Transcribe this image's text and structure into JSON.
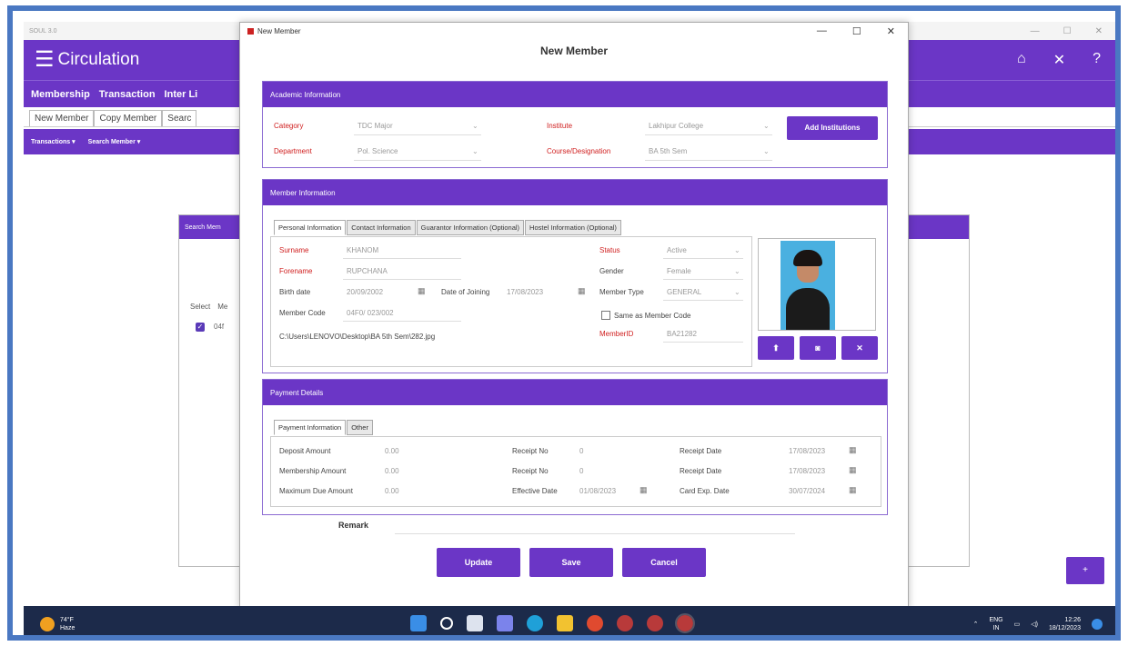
{
  "background_app": {
    "title": "SOUL 3.0",
    "header_title": "Circulation",
    "nav_items": [
      "Membership",
      "Transaction",
      "Inter Li"
    ],
    "tabs": [
      "New Member",
      "Copy Member",
      "Searc"
    ],
    "sub_nav": [
      "Transactions ▾",
      "Search Member ▾"
    ],
    "panel_title": "Search Mem",
    "select_col": "Select",
    "col2": "Me",
    "row_value": "04f",
    "right_button": "+"
  },
  "dialog": {
    "window_title": "New Member",
    "heading": "New Member",
    "academic": {
      "header": "Academic Information",
      "category_label": "Category",
      "category_value": "TDC Major",
      "institute_label": "Institute",
      "institute_value": "Lakhipur College",
      "department_label": "Department",
      "department_value": "Pol. Science",
      "course_label": "Course/Designation",
      "course_value": "BA 5th Sem",
      "add_button": "Add Institutions"
    },
    "member": {
      "header": "Member Information",
      "tabs": [
        "Personal Information",
        "Contact Information",
        "Guarantor Information (Optional)",
        "Hostel Information (Optional)"
      ],
      "surname_label": "Surname",
      "surname_value": "KHANOM",
      "forename_label": "Forename",
      "forename_value": "RUPCHANA",
      "birth_label": "Birth date",
      "birth_value": "20/09/2002",
      "joining_label": "Date of Joining",
      "joining_value": "17/08/2023",
      "member_code_label": "Member Code",
      "member_code_value": "04F0/ 023/002",
      "path": "C:\\Users\\LENOVO\\Desktop\\BA 5th Sem\\282.jpg",
      "status_label": "Status",
      "status_value": "Active",
      "gender_label": "Gender",
      "gender_value": "Female",
      "member_type_label": "Member Type",
      "member_type_value": "GENERAL",
      "same_as_label": "Same as Member Code",
      "memberid_label": "MemberID",
      "memberid_value": "BA21282"
    },
    "payment": {
      "header": "Payment Details",
      "tabs": [
        "Payment Information",
        "Other"
      ],
      "deposit_label": "Deposit Amount",
      "deposit_value": "0.00",
      "membership_label": "Membership Amount",
      "membership_value": "0.00",
      "maxdue_label": "Maximum Due Amount",
      "maxdue_value": "0.00",
      "receipt1_label": "Receipt No",
      "receipt1_value": "0",
      "receipt2_label": "Receipt No",
      "receipt2_value": "0",
      "effective_label": "Effective Date",
      "effective_value": "01/08/2023",
      "rdate1_label": "Receipt Date",
      "rdate1_value": "17/08/2023",
      "rdate2_label": "Receipt Date",
      "rdate2_value": "17/08/2023",
      "cardexp_label": "Card Exp. Date",
      "cardexp_value": "30/07/2024"
    },
    "remark_label": "Remark",
    "buttons": {
      "update": "Update",
      "save": "Save",
      "cancel": "Cancel"
    }
  },
  "taskbar": {
    "temp": "74°F",
    "weather": "Haze",
    "lang1": "ENG",
    "lang2": "IN",
    "time": "12:26",
    "date": "18/12/2023"
  },
  "colors": {
    "accent": "#6b36c6",
    "frame": "#4a78c2",
    "label_red": "#d02020"
  }
}
